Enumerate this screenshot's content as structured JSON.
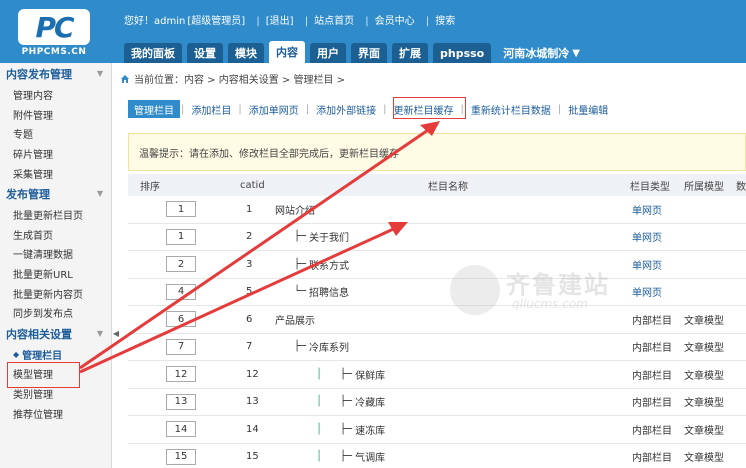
{
  "header": {
    "logo_text": "PC",
    "logo_sub": "PHPCMS.CN",
    "greeting": "您好！admin",
    "role": "[超级管理员]",
    "logout": "[退出]",
    "site_home": "站点首页",
    "member_center": "会员中心",
    "search": "搜索",
    "tabs": [
      {
        "label": "我的面板"
      },
      {
        "label": "设置"
      },
      {
        "label": "模块"
      },
      {
        "label": "内容"
      },
      {
        "label": "用户"
      },
      {
        "label": "界面"
      },
      {
        "label": "扩展"
      },
      {
        "label": "phpsso"
      }
    ],
    "site_select": "河南冰城制冷"
  },
  "sidebar": {
    "sections": [
      {
        "title": "内容发布管理",
        "items": [
          "管理内容",
          "附件管理",
          "专题",
          "碎片管理",
          "采集管理"
        ]
      },
      {
        "title": "发布管理",
        "items": [
          "批量更新栏目页",
          "生成首页",
          "一键清理数据",
          "批量更新URL",
          "批量更新内容页",
          "同步到发布点"
        ]
      },
      {
        "title": "内容相关设置",
        "items": [
          "管理栏目",
          "模型管理",
          "类别管理",
          "推荐位管理"
        ]
      }
    ]
  },
  "breadcrumb": "当前位置：内容 > 内容相关设置 > 管理栏目 >",
  "subtabs": [
    "管理栏目",
    "添加栏目",
    "添加单网页",
    "添加外部链接",
    "更新栏目缓存",
    "重新统计栏目数据",
    "批量编辑"
  ],
  "tip": "温馨提示：请在添加、修改栏目全部完成后，更新栏目缓存",
  "table": {
    "headers": {
      "order": "排序",
      "catid": "catid",
      "name": "栏目名称",
      "type": "栏目类型",
      "model": "所属模型",
      "extra": "数"
    },
    "rows": [
      {
        "order": "1",
        "catid": "1",
        "prefix": "",
        "name": "网站介绍",
        "type": "单网页",
        "model": "",
        "link": true
      },
      {
        "order": "1",
        "catid": "2",
        "prefix": "├─",
        "name": "关于我们",
        "type": "单网页",
        "model": "",
        "link": true
      },
      {
        "order": "2",
        "catid": "3",
        "prefix": "├─",
        "name": "联系方式",
        "type": "单网页",
        "model": "",
        "link": true
      },
      {
        "order": "4",
        "catid": "5",
        "prefix": "└─",
        "name": "招聘信息",
        "type": "单网页",
        "model": "",
        "link": true
      },
      {
        "order": "6",
        "catid": "6",
        "prefix": "",
        "name": "产品展示",
        "type": "内部栏目",
        "model": "文章模型",
        "link": false
      },
      {
        "order": "7",
        "catid": "7",
        "prefix": "├─",
        "name": "冷库系列",
        "type": "内部栏目",
        "model": "文章模型",
        "link": false
      },
      {
        "order": "12",
        "catid": "12",
        "prefix": "├─",
        "name": "保鲜库",
        "type": "内部栏目",
        "model": "文章模型",
        "link": false
      },
      {
        "order": "13",
        "catid": "13",
        "prefix": "├─",
        "name": "冷藏库",
        "type": "内部栏目",
        "model": "文章模型",
        "link": false
      },
      {
        "order": "14",
        "catid": "14",
        "prefix": "├─",
        "name": "速冻库",
        "type": "内部栏目",
        "model": "文章模型",
        "link": false
      },
      {
        "order": "15",
        "catid": "15",
        "prefix": "├─",
        "name": "气调库",
        "type": "内部栏目",
        "model": "文章模型",
        "link": false
      }
    ]
  },
  "watermark": {
    "title": "齐鲁建站",
    "url": "qllucms.com"
  },
  "colors": {
    "header": "#2f8bc9",
    "accent": "#1d5d9a",
    "annotation": "#e53b3b"
  }
}
